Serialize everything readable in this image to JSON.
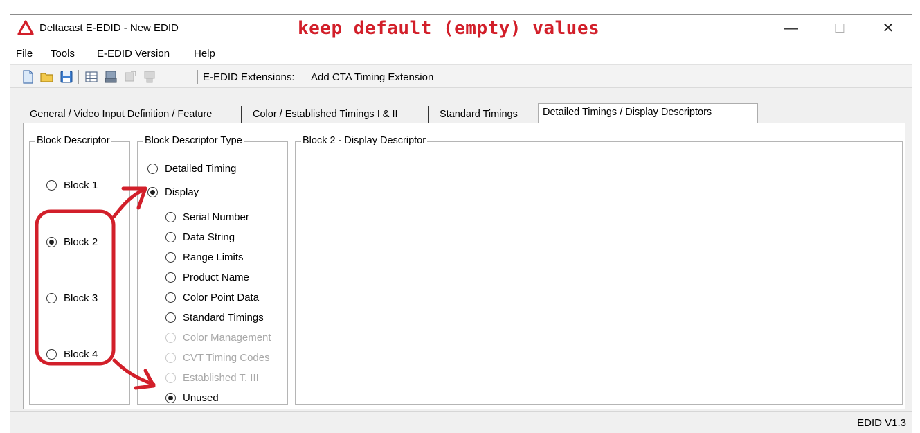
{
  "window": {
    "title": "Deltacast E-EDID - New EDID",
    "annotation": "keep default (empty) values",
    "controls": {
      "minimize": "—",
      "maximize": "☐",
      "close": "✕"
    }
  },
  "menu": [
    "File",
    "Tools",
    "E-EDID Version",
    "Help"
  ],
  "toolbar": {
    "extensions_label": "E-EDID Extensions:",
    "extensions_value": "Add CTA Timing Extension"
  },
  "tabs": [
    {
      "label": "General / Video Input Definition / Feature"
    },
    {
      "label": "Color / Established Timings I & II"
    },
    {
      "label": "Standard Timings"
    },
    {
      "label": "Detailed Timings / Display Descriptors",
      "active": true
    }
  ],
  "block_descriptor": {
    "title": "Block Descriptor",
    "options": [
      {
        "label": "Block 1",
        "checked": false
      },
      {
        "label": "Block 2",
        "checked": true
      },
      {
        "label": "Block 3",
        "checked": false
      },
      {
        "label": "Block 4",
        "checked": false
      }
    ]
  },
  "block_type": {
    "title": "Block Descriptor Type",
    "main_options": [
      {
        "label": "Detailed Timing",
        "checked": false
      },
      {
        "label": "Display",
        "checked": true
      }
    ],
    "display_options": [
      {
        "label": "Serial Number",
        "checked": false,
        "enabled": true
      },
      {
        "label": "Data String",
        "checked": false,
        "enabled": true
      },
      {
        "label": "Range Limits",
        "checked": false,
        "enabled": true
      },
      {
        "label": "Product Name",
        "checked": false,
        "enabled": true
      },
      {
        "label": "Color Point Data",
        "checked": false,
        "enabled": true
      },
      {
        "label": "Standard Timings",
        "checked": false,
        "enabled": true
      },
      {
        "label": "Color Management",
        "checked": false,
        "enabled": false
      },
      {
        "label": "CVT Timing Codes",
        "checked": false,
        "enabled": false
      },
      {
        "label": "Established T. III",
        "checked": false,
        "enabled": false
      },
      {
        "label": "Unused",
        "checked": true,
        "enabled": true
      }
    ]
  },
  "detail_panel": {
    "title": "Block 2 -  Display Descriptor"
  },
  "status": {
    "version": "EDID V1.3"
  },
  "colors": {
    "annotation": "#d21f2a",
    "window_bg": "#f0f0f0",
    "panel_bg": "#ffffff"
  }
}
